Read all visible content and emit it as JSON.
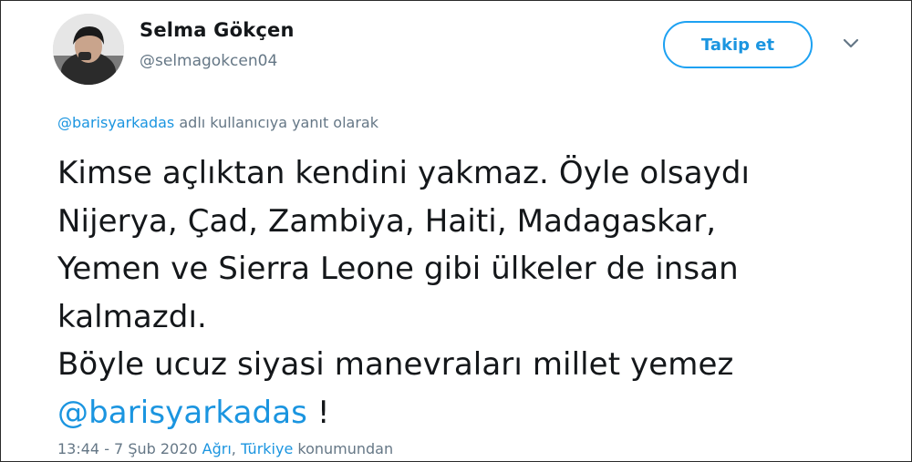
{
  "author": {
    "display_name": "Selma Gökçen",
    "handle": "@selmagokcen04"
  },
  "actions": {
    "follow_label": "Takip et",
    "more_icon": "chevron-down-icon"
  },
  "reply_context": {
    "mention": "@barisyarkadas",
    "suffix": " adlı kullanıcıya yanıt olarak"
  },
  "tweet": {
    "text": "Kimse açlıktan kendini yakmaz. Öyle olsaydı\nNijerya, Çad, Zambiya, Haiti, Madagaskar,\nYemen ve Sierra Leone gibi ülkeler de insan\nkalmazdı.\nBöyle ucuz siyasi manevraları millet yemez\n",
    "mention": "@barisyarkadas",
    "trailing": " !"
  },
  "meta": {
    "timestamp": "13:44 - 7 Şub 2020 ",
    "place_city": "Ağrı",
    "separator": ", ",
    "place_country": "Türkiye",
    "suffix": " konumundan"
  },
  "colors": {
    "link": "#1b95e0",
    "text": "#14171a",
    "muted": "#657786",
    "button_border": "#1da1f2"
  }
}
